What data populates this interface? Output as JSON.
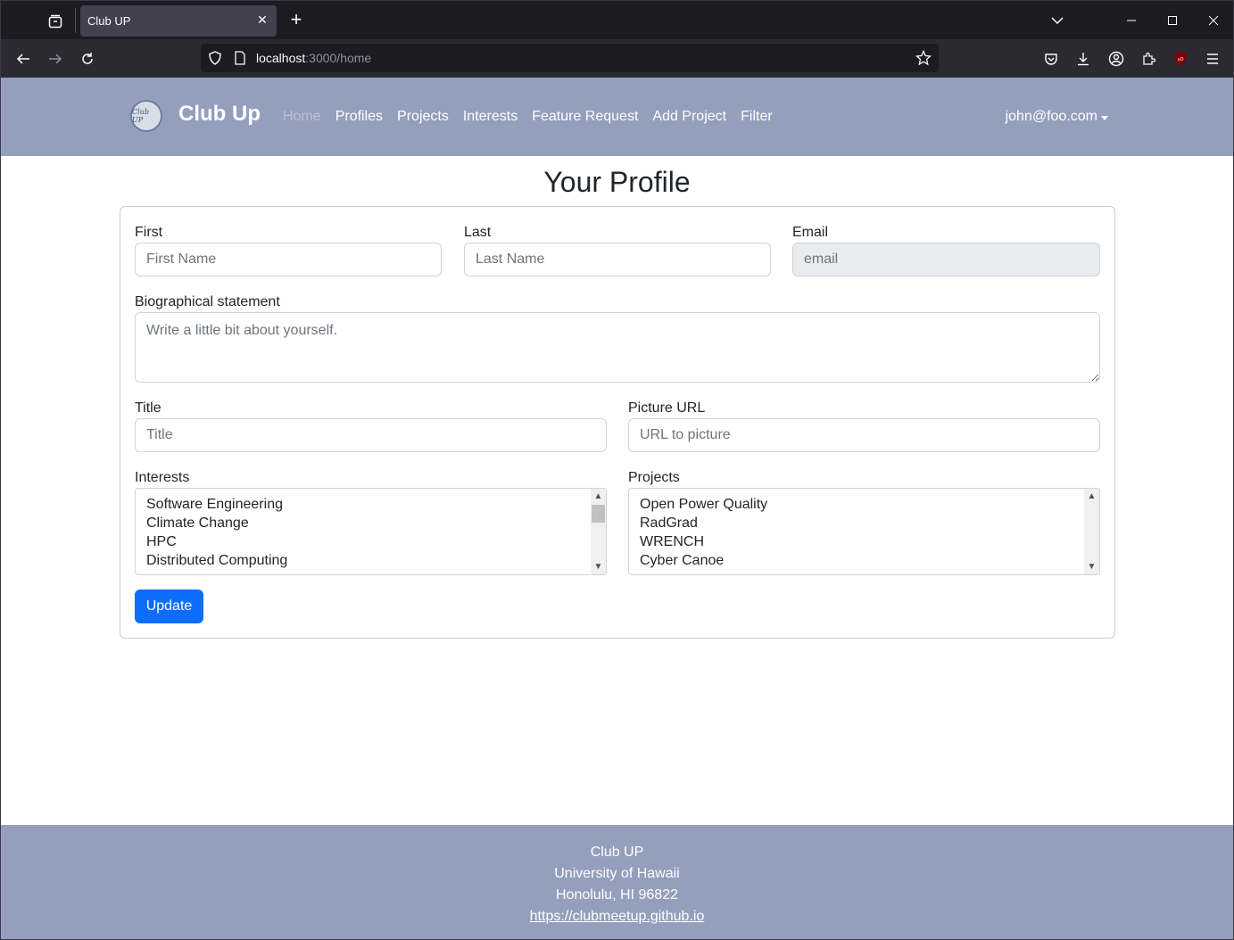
{
  "browser": {
    "tab_title": "Club UP",
    "url_host": "localhost",
    "url_path": ":3000/home"
  },
  "nav": {
    "brand": "Club Up",
    "logo_text": "Club UP",
    "links": [
      "Home",
      "Profiles",
      "Projects",
      "Interests",
      "Feature Request",
      "Add Project",
      "Filter"
    ],
    "user": "john@foo.com"
  },
  "page": {
    "title": "Your Profile"
  },
  "form": {
    "first_label": "First",
    "first_placeholder": "First Name",
    "last_label": "Last",
    "last_placeholder": "Last Name",
    "email_label": "Email",
    "email_placeholder": "email",
    "bio_label": "Biographical statement",
    "bio_placeholder": "Write a little bit about yourself.",
    "title_label": "Title",
    "title_placeholder": "Title",
    "picture_label": "Picture URL",
    "picture_placeholder": "URL to picture",
    "interests_label": "Interests",
    "interests_options": [
      "Software Engineering",
      "Climate Change",
      "HPC",
      "Distributed Computing"
    ],
    "projects_label": "Projects",
    "projects_options": [
      "Open Power Quality",
      "RadGrad",
      "WRENCH",
      "Cyber Canoe"
    ],
    "update_label": "Update"
  },
  "footer": {
    "line1": "Club UP",
    "line2": "University of Hawaii",
    "line3": "Honolulu, HI 96822",
    "link": "https://clubmeetup.github.io"
  },
  "colors": {
    "navbar_bg": "#949fbd",
    "primary_button": "#0d6efd",
    "browser_dark": "#1c1b22"
  }
}
